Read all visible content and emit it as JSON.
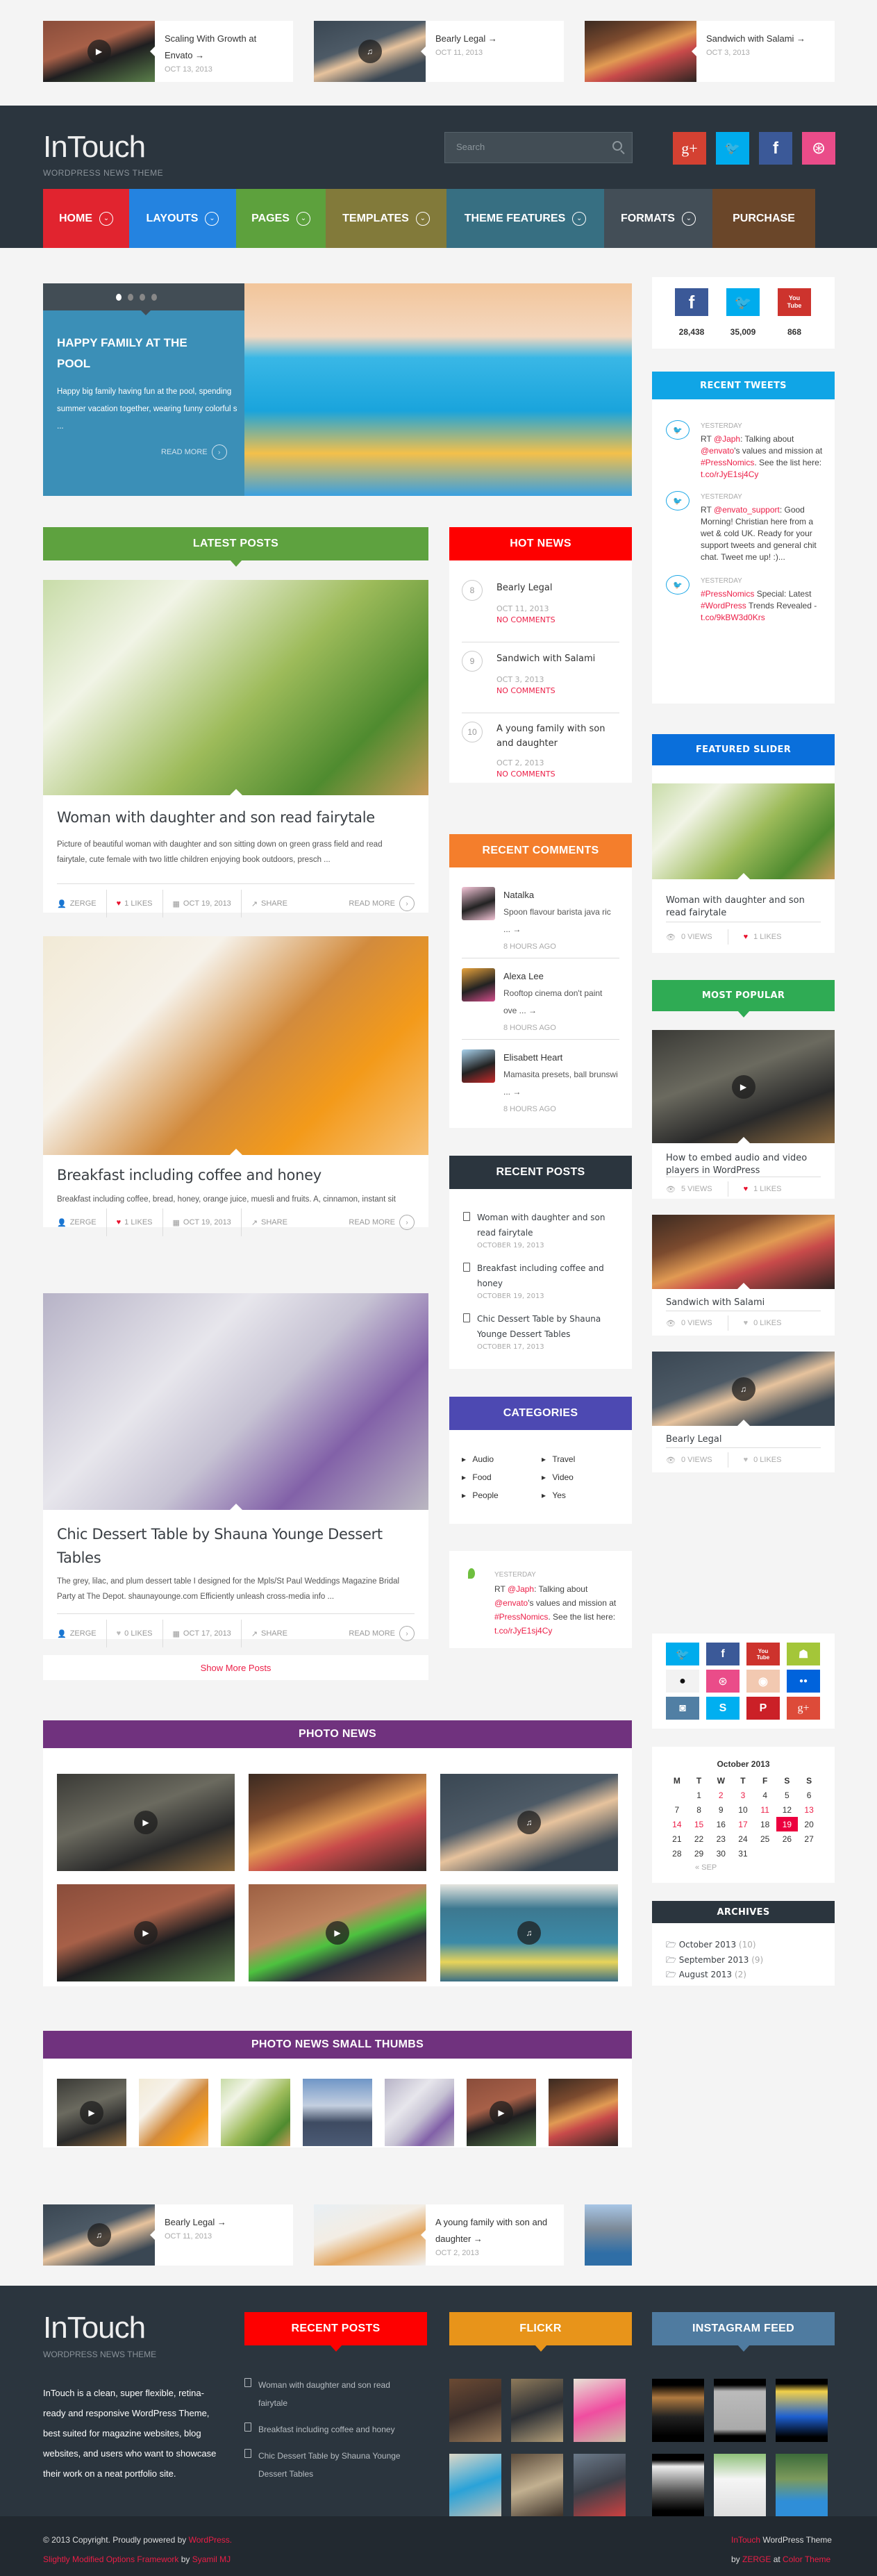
{
  "related_top": [
    {
      "title": "Scaling With Growth at Envato →",
      "date": "OCT 13, 2013",
      "image": "video-man",
      "icon": "play-icon"
    },
    {
      "title": "Bearly Legal →",
      "date": "OCT 11, 2013",
      "image": "white-panda",
      "icon": null
    },
    {
      "title": "Sandwich with Salami →",
      "date": "OCT 3, 2013",
      "image": "sandwich",
      "icon": null
    }
  ],
  "header": {
    "logo": "InTouch",
    "tagline": "WORDPRESS NEWS THEME",
    "search_placeholder": "Search",
    "social": [
      {
        "name": "google-plus",
        "glyph": "g+",
        "color": "#d44132"
      },
      {
        "name": "twitter",
        "glyph": "🐦",
        "color": "#00aced"
      },
      {
        "name": "facebook",
        "glyph": "f",
        "color": "#3b5998"
      },
      {
        "name": "dribbble",
        "glyph": "⊛",
        "color": "#ea4c89"
      }
    ]
  },
  "nav": [
    {
      "label": "HOME",
      "color": "#e1242f",
      "dropdown": true
    },
    {
      "label": "LAYOUTS",
      "color": "#2483e0",
      "dropdown": true
    },
    {
      "label": "PAGES",
      "color": "#5da13d",
      "dropdown": true
    },
    {
      "label": "TEMPLATES",
      "color": "#827a3a",
      "dropdown": true
    },
    {
      "label": "THEME FEATURES",
      "color": "#376f82",
      "dropdown": true
    },
    {
      "label": "FORMATS",
      "color": "#434e57",
      "dropdown": true
    },
    {
      "label": "PURCHASE",
      "color": "#6a4629",
      "dropdown": false
    }
  ],
  "slider": {
    "dots": 4,
    "active_dot": 1,
    "title": "HAPPY FAMILY AT THE POOL",
    "excerpt": "Happy big family having fun at the pool, spending summer vacation together, wearing funny colorful s ...",
    "read_more": "READ MORE"
  },
  "social_counters": [
    {
      "network": "facebook",
      "count": "28,438",
      "color": "#3b5998"
    },
    {
      "network": "twitter",
      "count": "35,009",
      "color": "#00aced"
    },
    {
      "network": "youtube",
      "count": "868",
      "color": "#cd332d"
    }
  ],
  "latest_posts": {
    "title": "LATEST POSTS",
    "color": "#5ea23f",
    "posts": [
      {
        "title": "Woman with daughter and son read fairytale",
        "excerpt": "Picture of beautiful woman with daughter and son sitting down on green grass field and read fairytale, cute female with two little children enjoying book outdoors, presch ...",
        "author": "ZERGE",
        "likes": "1 LIKES",
        "liked": true,
        "date": "OCT 19, 2013",
        "share": "SHARE",
        "read_more": "READ MORE"
      },
      {
        "title": "Breakfast including coffee and honey",
        "excerpt": "Breakfast including coffee, bread, honey, orange juice, muesli and fruits. A, cinnamon, instant sit breve extraction aftertaste. Cup americano aroma, aftertaste froth caf ...",
        "author": "ZERGE",
        "likes": "1 LIKES",
        "liked": true,
        "date": "OCT 19, 2013",
        "share": "SHARE",
        "read_more": "READ MORE"
      },
      {
        "title": "Chic Dessert Table by Shauna Younge Dessert Tables",
        "excerpt": "The grey, lilac, and plum dessert table I designed for the Mpls/St Paul Weddings Magazine Bridal Party at The Depot. shaunayounge.com Efficiently unleash cross-media info ...",
        "author": "ZERGE",
        "likes": "0 LIKES",
        "liked": false,
        "date": "OCT 17, 2013",
        "share": "SHARE",
        "read_more": "READ MORE"
      }
    ],
    "show_more": "Show More Posts"
  },
  "hot_news": {
    "title": "HOT NEWS",
    "color": "#fe0000",
    "items": [
      {
        "num": "8",
        "title": "Bearly Legal",
        "date": "OCT 11, 2013",
        "comments": "NO COMMENTS"
      },
      {
        "num": "9",
        "title": "Sandwich with Salami",
        "date": "OCT 3, 2013",
        "comments": "NO COMMENTS"
      },
      {
        "num": "10",
        "title": "A young family with son and daughter",
        "date": "OCT 2, 2013",
        "comments": "NO COMMENTS"
      }
    ]
  },
  "recent_comments": {
    "title": "RECENT COMMENTS",
    "color": "#f47e2c",
    "items": [
      {
        "author": "Natalka",
        "text": "Spoon flavour barista java ric ... →",
        "time": "8 HOURS AGO"
      },
      {
        "author": "Alexa Lee",
        "text": "Rooftop cinema don't paint ove ... →",
        "time": "8 HOURS AGO"
      },
      {
        "author": "Elisabett Heart",
        "text": "Mamasita presets, ball brunswi ... →",
        "time": "8 HOURS AGO"
      }
    ]
  },
  "recent_posts_mid": {
    "title": "RECENT POSTS",
    "color": "#2b353e",
    "items": [
      {
        "title": "Woman with daughter and son read fairytale",
        "date": "OCTOBER 19, 2013"
      },
      {
        "title": "Breakfast including coffee and honey",
        "date": "OCTOBER 19, 2013"
      },
      {
        "title": "Chic Dessert Table by Shauna Younge Dessert Tables",
        "date": "OCTOBER 17, 2013"
      }
    ]
  },
  "categories": {
    "title": "CATEGORIES",
    "color": "#4d49b2",
    "items": [
      "Audio",
      "Travel",
      "Food",
      "Video",
      "People",
      "Yes"
    ]
  },
  "envato_tweet": {
    "time": "YESTERDAY",
    "parts": [
      "RT ",
      "@Japh",
      ": Talking about ",
      "@envato",
      "'s values and mission at ",
      "#PressNomics",
      ". See the list here: ",
      "t.co/rJyE1sj4Cy"
    ]
  },
  "recent_tweets": {
    "title": "RECENT TWEETS",
    "color": "#10a5e6",
    "items": [
      {
        "time": "YESTERDAY",
        "parts": [
          "RT ",
          "@Japh",
          ": Talking about ",
          "@envato",
          "'s values and mission at ",
          "#PressNomics",
          ". See the list here: ",
          "t.co/rJyE1sj4Cy"
        ]
      },
      {
        "time": "YESTERDAY",
        "parts": [
          "RT ",
          "@envato_support",
          ": Good Morning! Christian here from a wet & cold UK. Ready for your support tweets and general chit chat. Tweet me up! :)...",
          "",
          "",
          "",
          "",
          ""
        ]
      },
      {
        "time": "YESTERDAY",
        "parts": [
          "",
          "#PressNomics",
          " Special: Latest ",
          "#WordPress",
          " Trends Revealed - ",
          "t.co/9kBW3d0Krs",
          "",
          ""
        ]
      }
    ]
  },
  "featured_slider": {
    "title": "FEATURED SLIDER",
    "color": "#0a6fdb",
    "post_title": "Woman with daughter and son read fairytale",
    "views": "0 VIEWS",
    "likes": "1 LIKES"
  },
  "most_popular": {
    "title": "MOST POPULAR",
    "color": "#2fab54",
    "items": [
      {
        "title": "How to embed audio and video players in WordPress",
        "views": "5 VIEWS",
        "likes": "1 LIKES",
        "liked": true
      },
      {
        "title": "Sandwich with Salami",
        "views": "0 VIEWS",
        "likes": "0 LIKES",
        "liked": false
      },
      {
        "title": "Bearly Legal",
        "views": "0 VIEWS",
        "likes": "0 LIKES",
        "liked": false
      }
    ]
  },
  "social_grid": [
    {
      "name": "twitter",
      "glyph": "🐦",
      "color": "#00aced"
    },
    {
      "name": "facebook",
      "glyph": "f",
      "color": "#3b5998"
    },
    {
      "name": "youtube",
      "glyph": "You Tube",
      "color": "#cd332d"
    },
    {
      "name": "android",
      "glyph": "☗",
      "color": "#a4c639"
    },
    {
      "name": "apple",
      "glyph": "",
      "color": "#f2f2f2"
    },
    {
      "name": "dribbble",
      "glyph": "⊛",
      "color": "#ea4c89"
    },
    {
      "name": "github",
      "glyph": "◉",
      "color": "#f2c9b1"
    },
    {
      "name": "flickr",
      "glyph": "●●",
      "color": "#0063dc"
    },
    {
      "name": "instagram",
      "glyph": "◙",
      "color": "#517fa4"
    },
    {
      "name": "skype",
      "glyph": "S",
      "color": "#00aff0"
    },
    {
      "name": "pinterest",
      "glyph": "P",
      "color": "#cb2027"
    },
    {
      "name": "google-plus",
      "glyph": "g+",
      "color": "#dd4b39"
    }
  ],
  "calendar": {
    "caption": "October 2013",
    "headers": [
      "M",
      "T",
      "W",
      "T",
      "F",
      "S",
      "S"
    ],
    "weeks": [
      [
        "",
        "1",
        "2",
        "3",
        "4",
        "5",
        "6"
      ],
      [
        "7",
        "8",
        "9",
        "10",
        "11",
        "12",
        "13"
      ],
      [
        "14",
        "15",
        "16",
        "17",
        "18",
        "19",
        "20"
      ],
      [
        "21",
        "22",
        "23",
        "24",
        "25",
        "26",
        "27"
      ],
      [
        "28",
        "29",
        "30",
        "31",
        "",
        "",
        ""
      ]
    ],
    "linked_days": [
      "2",
      "3",
      "11",
      "13",
      "14",
      "15",
      "17"
    ],
    "today": "19",
    "prev": "« SEP"
  },
  "archives": {
    "title": "ARCHIVES",
    "color": "#2b353e",
    "items": [
      {
        "label": "October 2013",
        "count": "(10)"
      },
      {
        "label": "September 2013",
        "count": "(9)"
      },
      {
        "label": "August 2013",
        "count": "(2)"
      }
    ]
  },
  "photo_news": {
    "title": "PHOTO NEWS",
    "color": "#70327e",
    "items": [
      "envato-update-video",
      "sandwich",
      "white-panda-audio",
      "james-ross-video",
      "envato-sign-video",
      "andrew-belle-audio"
    ]
  },
  "photo_news_small": {
    "title": "PHOTO NEWS SMALL THUMBS",
    "color": "#70327e",
    "items": [
      "envato-update-video",
      "breakfast",
      "family",
      "city-skyline",
      "dessert",
      "james-ross-video",
      "sandwich"
    ]
  },
  "related_bottom": [
    {
      "title": "Bearly Legal →",
      "date": "OCT 11, 2013"
    },
    {
      "title": "A young family with son and daughter →",
      "date": "OCT 2, 2013"
    }
  ],
  "footer": {
    "logo": "InTouch",
    "tagline": "WORDPRESS NEWS THEME",
    "about": "InTouch is a clean, super flexible, retina-ready and responsive WordPress Theme, best suited for magazine websites, blog websites, and users who want to showcase their work on a neat portfolio site.",
    "recent_posts": {
      "title": "RECENT POSTS",
      "color": "#fe0000",
      "items": [
        "Woman with daughter and son read fairytale",
        "Breakfast including coffee and honey",
        "Chic Dessert Table by Shauna Younge Dessert Tables"
      ]
    },
    "flickr": {
      "title": "FLICKR",
      "color": "#e8941a"
    },
    "instagram": {
      "title": "INSTAGRAM FEED",
      "color": "#4f7ba0"
    },
    "copyright": "© 2013 Copyright. Proudly powered by ",
    "wordpress_link": "WordPress.",
    "framework_link": "Slightly Modified Options Framework",
    "by": " by ",
    "syamil_link": "Syamil MJ",
    "theme_link": "InTouch",
    "theme_text": " WordPress Theme",
    "by2": "by ",
    "zerge_link": "ZERGE",
    "at": " at ",
    "colortheme_link": "Color Theme"
  }
}
